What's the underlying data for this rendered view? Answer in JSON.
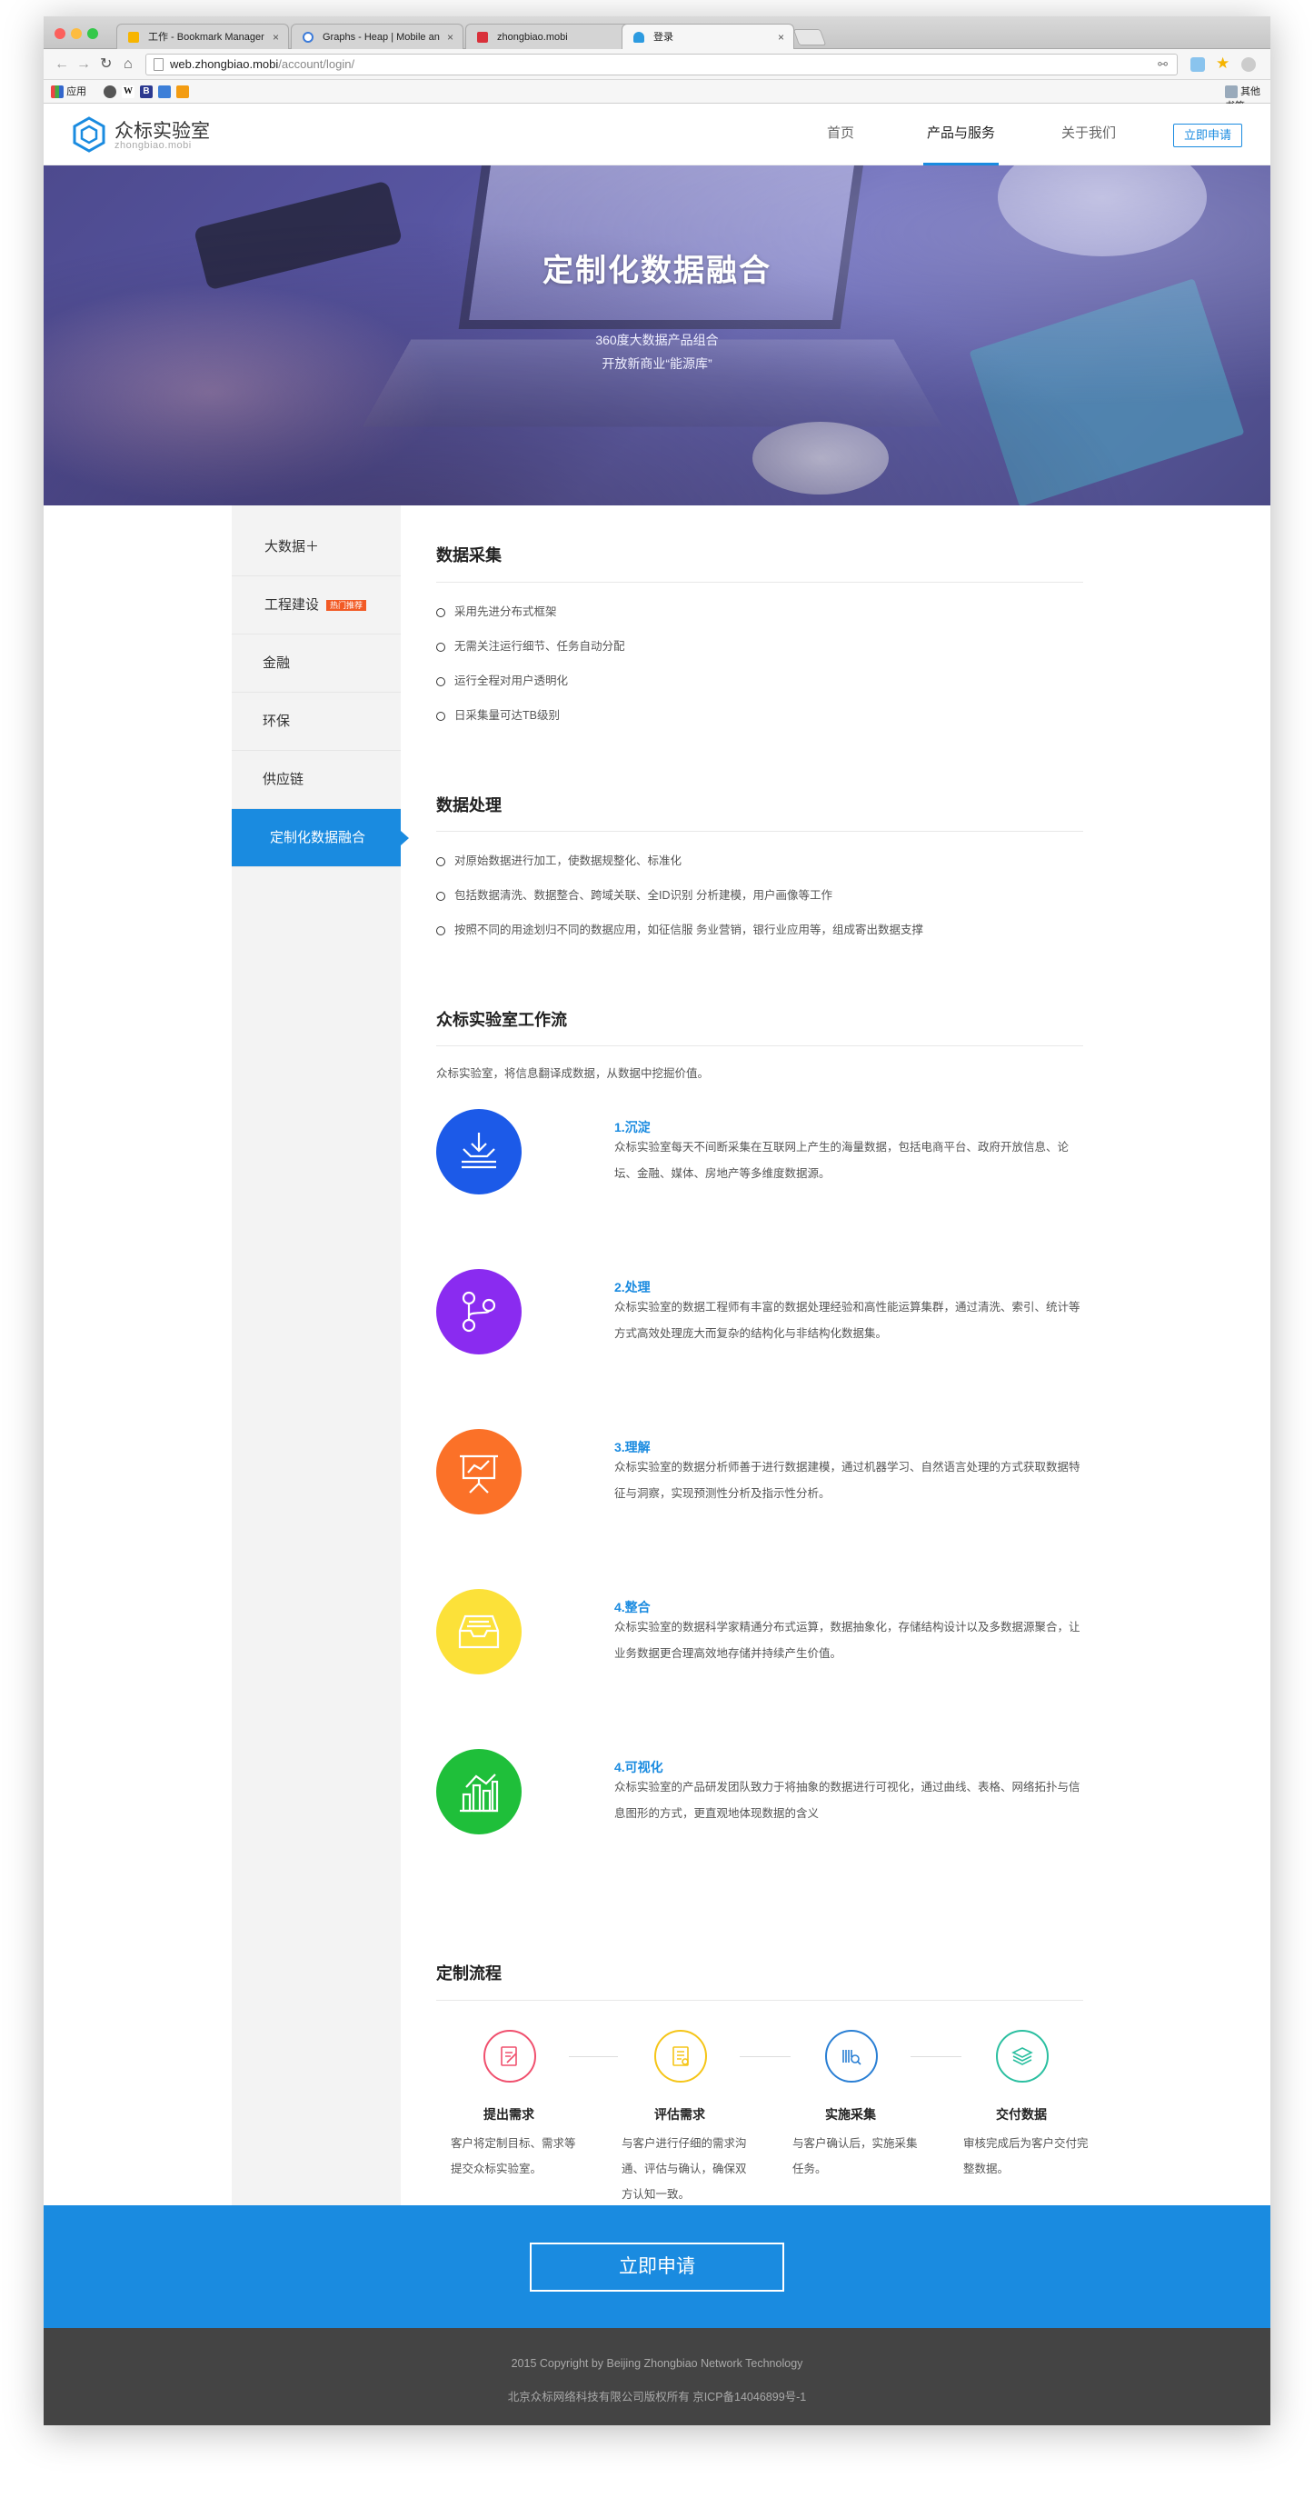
{
  "browser": {
    "tabs": [
      {
        "title": "工作 - Bookmark Manager",
        "active": false
      },
      {
        "title": "Graphs - Heap | Mobile an",
        "active": false
      },
      {
        "title": "zhongbiao.mobi",
        "active": false
      },
      {
        "title": "登录",
        "active": true
      }
    ],
    "close_glyph": "×",
    "url_host": "web.zhongbiao.mobi",
    "url_path": "/account/login/",
    "bookmarks": {
      "apps_label": "应用",
      "w_label": "W",
      "b_label": "B",
      "other_label": "其他书签"
    }
  },
  "header": {
    "logo_name": "众标实验室",
    "logo_sub": "zhongbiao.mobi",
    "nav": [
      {
        "label": "首页"
      },
      {
        "label": "产品与服务"
      },
      {
        "label": "关于我们"
      }
    ],
    "apply_label": "立即申请"
  },
  "banner": {
    "title": "定制化数据融合",
    "line1": "360度大数据产品组合",
    "line2": "开放新商业“能源库”"
  },
  "sidebar": {
    "items": [
      {
        "label": "大数据＋"
      },
      {
        "label": "工程建设",
        "badge": "热门推荐"
      },
      {
        "label": "金融"
      },
      {
        "label": "环保"
      },
      {
        "label": "供应链"
      },
      {
        "label": "定制化数据融合"
      }
    ]
  },
  "collect": {
    "title": "数据采集",
    "bullets": [
      "采用先进分布式框架",
      "无需关注运行细节、任务自动分配",
      "运行全程对用户透明化",
      "日采集量可达TB级别"
    ]
  },
  "process": {
    "title": "数据处理",
    "bullets": [
      "对原始数据进行加工，使数据规整化、标准化",
      "包括数据清洗、数据整合、跨域关联、全ID识别 分析建模，用户画像等工作",
      "按照不同的用途划归不同的数据应用，如征信服 务业营销，银行业应用等，组成寄出数据支撑"
    ]
  },
  "workflow": {
    "title": "众标实验室工作流",
    "intro": "众标实验室，将信息翻译成数据，从数据中挖掘价值。",
    "items": [
      {
        "title": "1.沉淀",
        "desc": "众标实验室每天不间断采集在互联网上产生的海量数据，包括电商平台、政府开放信息、论坛、金融、媒体、房地产等多维度数据源。",
        "icon": "download-tray-icon",
        "color": "#1c5ae8"
      },
      {
        "title": "2.处理",
        "desc": "众标实验室的数据工程师有丰富的数据处理经验和高性能运算集群，通过清洗、索引、统计等方式高效处理庞大而复杂的结构化与非结构化数据集。",
        "icon": "git-branch-icon",
        "color": "#8a2bf0"
      },
      {
        "title": "3.理解",
        "desc": "众标实验室的数据分析师善于进行数据建模，通过机器学习、自然语言处理的方式获取数据特征与洞察，实现预测性分析及指示性分析。",
        "icon": "presentation-chart-icon",
        "color": "#fb7128"
      },
      {
        "title": "4.整合",
        "desc": "众标实验室的数据科学家精通分布式运算，数据抽象化，存储结构设计以及多数据源聚合，让业务数据更合理高效地存储并持续产生价值。",
        "icon": "inbox-tray-icon",
        "color": "#fce139"
      },
      {
        "title": "4.可视化",
        "desc": "众标实验室的产品研发团队致力于将抽象的数据进行可视化，通过曲线、表格、网络拓扑与信息图形的方式，更直观地体现数据的含义",
        "icon": "bar-chart-icon",
        "color": "#1fbf3a"
      }
    ]
  },
  "custom_flow": {
    "title": "定制流程",
    "steps": [
      {
        "title": "提出需求",
        "desc": "客户将定制目标、需求等提交众标实验室。",
        "color": "#f0506e",
        "icon": "edit-document-icon"
      },
      {
        "title": "评估需求",
        "desc": "与客户进行仔细的需求沟通、评估与确认，确保双方认知一致。",
        "color": "#f5c518",
        "icon": "evaluate-document-icon"
      },
      {
        "title": "实施采集",
        "desc": "与客户确认后，实施采集任务。",
        "color": "#2a7fd4",
        "icon": "barcode-scan-icon"
      },
      {
        "title": "交付数据",
        "desc": "审核完成后为客户交付完整数据。",
        "color": "#2bbfa0",
        "icon": "layers-icon"
      }
    ]
  },
  "cta": {
    "label": "立即申请"
  },
  "footer": {
    "line1": "2015 Copyright by Beijing Zhongbiao Network Technology",
    "line2": "北京众标网络科技有限公司版权所有 京ICP备14046899号-1"
  }
}
